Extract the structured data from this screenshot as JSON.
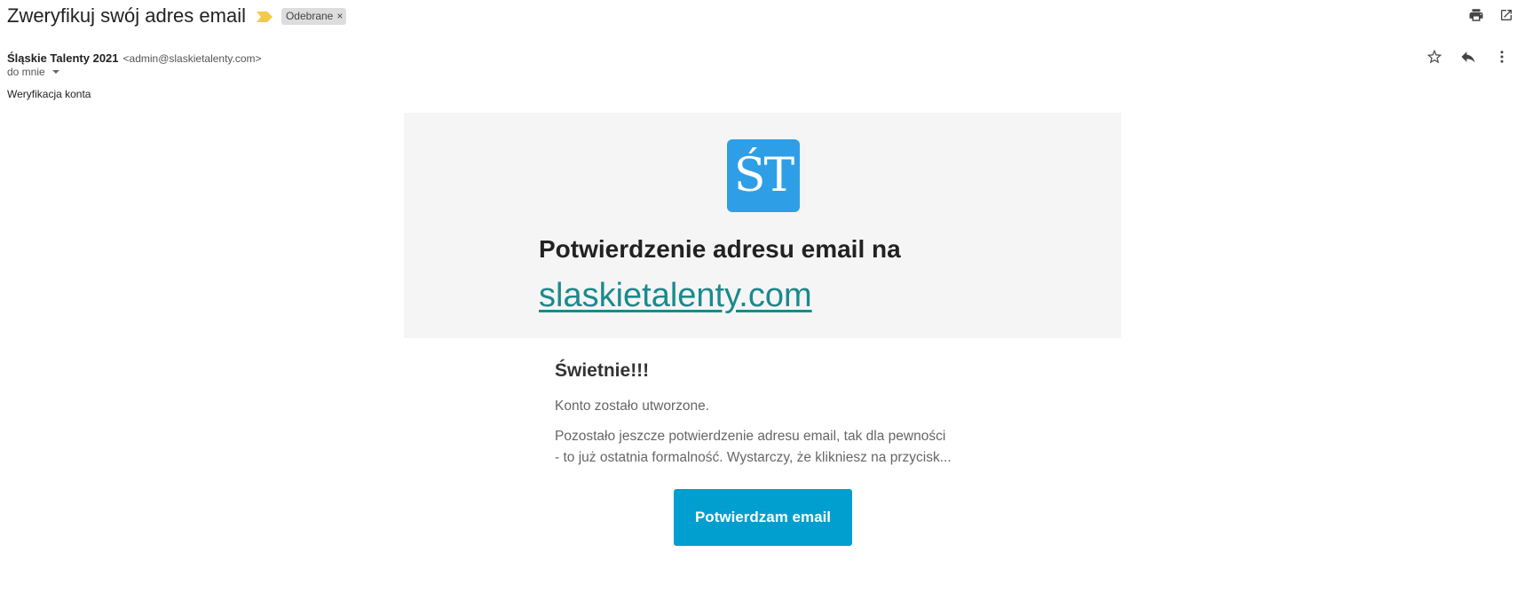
{
  "header": {
    "subject": "Zweryfikuj swój adres email",
    "label_chip": "Odebrane",
    "chip_remove": "×",
    "icons": [
      "important-marker-icon",
      "print-icon",
      "open-in-new-window-icon"
    ]
  },
  "message": {
    "sender_name": "Śląskie Talenty 2021",
    "sender_email": "<admin@slaskietalenty.com>",
    "to_label": "do mnie",
    "preheader": "Weryfikacja konta",
    "actions": [
      "star-icon",
      "reply-icon",
      "more-options-icon"
    ]
  },
  "email": {
    "logo_text": "ŚT",
    "logo_color": "#2e9fe6",
    "hero_title": "Potwierdzenie adresu email na",
    "hero_link": "slaskietalenty.com",
    "hero_link_color": "#1a8a8c",
    "hero_background": "#f5f5f5",
    "heading": "Świetnie!!!",
    "paragraph1": "Konto zostało utworzone.",
    "paragraph2_line1": "Pozostało jeszcze potwierdzenie adresu email, tak dla pewności",
    "paragraph2_line2": "- to już ostatnia formalność. Wystarczy, że klikniesz na przycisk...",
    "button_label": "Potwierdzam email",
    "button_color": "#009fcf"
  }
}
